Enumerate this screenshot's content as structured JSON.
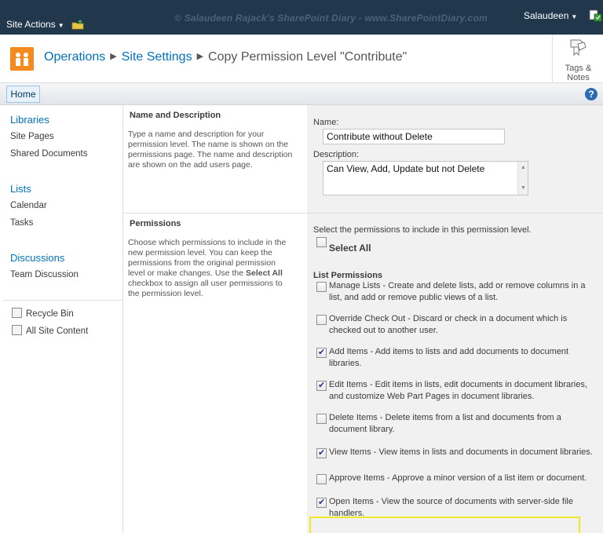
{
  "topbar": {
    "site_actions": "Site Actions",
    "watermark": "© Salaudeen Rajack's SharePoint Diary - www.SharePointDiary.com",
    "user": "Salaudeen"
  },
  "title": {
    "crumb1": "Operations",
    "crumb2": "Site Settings",
    "crumb3": "Copy Permission Level \"Contribute\"",
    "separator": "▶",
    "tags_line1": "Tags &",
    "tags_line2": "Notes"
  },
  "topnav": {
    "home": "Home",
    "help": "?"
  },
  "quicklaunch": {
    "libraries": "Libraries",
    "site_pages": "Site Pages",
    "shared_documents": "Shared Documents",
    "lists": "Lists",
    "calendar": "Calendar",
    "tasks": "Tasks",
    "discussions": "Discussions",
    "team_discussion": "Team Discussion",
    "recycle_bin": "Recycle Bin",
    "all_site_content": "All Site Content"
  },
  "name_section": {
    "title": "Name and Description",
    "description": "Type a name and description for your permission level.  The name is shown on the permissions page.  The name and description are shown on the add users page.",
    "name_label": "Name:",
    "name_value": "Contribute without Delete",
    "desc_label": "Description:",
    "desc_value": "Can View, Add, Update but not Delete"
  },
  "permissions_section": {
    "title": "Permissions",
    "description_pre": "Choose which permissions to include in the new permission level.  You can keep the permissions from the original permission level or make changes.  Use the ",
    "description_bold": "Select All",
    "description_post": " checkbox to assign all user permissions to the permission level.",
    "intro": "Select the permissions to include in this permission level.",
    "select_all": "Select All",
    "group": "List Permissions",
    "items": [
      {
        "text": "Manage Lists  -  Create and delete lists, add or remove columns in a list, and add or remove public views of a list.",
        "checked": false
      },
      {
        "text": "Override Check Out  -  Discard or check in a document which is checked out to another user.",
        "checked": false
      },
      {
        "text": "Add Items  -  Add items to lists and add documents to document libraries.",
        "checked": true
      },
      {
        "text": "Edit Items  -  Edit items in lists, edit documents in document libraries, and customize Web Part Pages in document libraries.",
        "checked": true
      },
      {
        "text": "Delete Items  -  Delete items from a list and documents from a document library.",
        "checked": false
      },
      {
        "text": "View Items  -  View items in lists and documents in document libraries.",
        "checked": true
      },
      {
        "text": "Approve Items  -  Approve a minor version of a list item or document.",
        "checked": false
      },
      {
        "text": "Open Items  -  View the source of documents with server-side file handlers.",
        "checked": true
      }
    ]
  },
  "colors": {
    "topbar": "#21374c",
    "link": "#0072bc",
    "highlight": "#f2e62b",
    "logo": "#f58a1f"
  }
}
